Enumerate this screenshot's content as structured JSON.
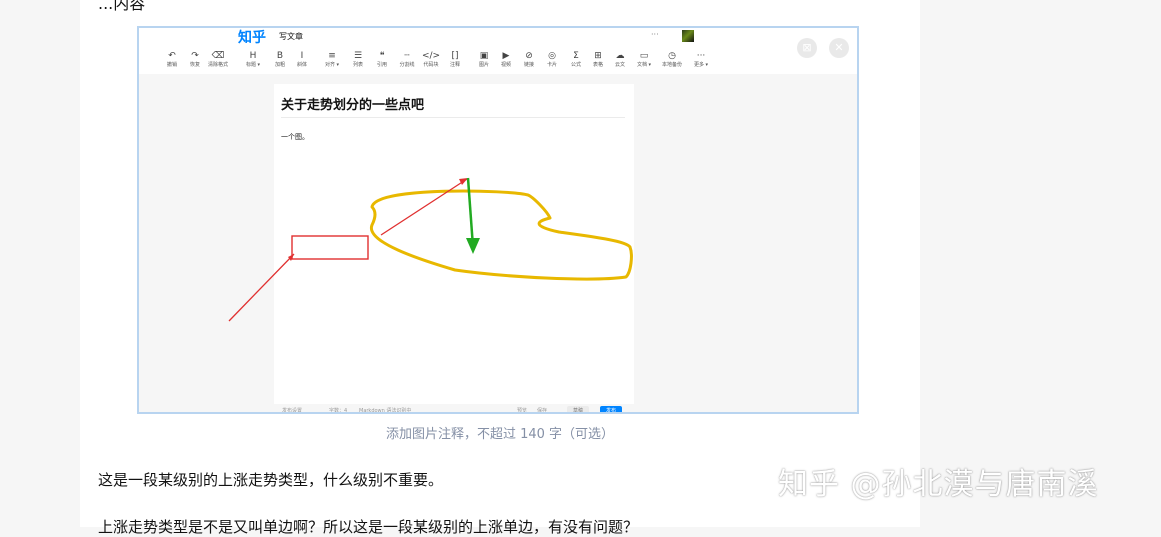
{
  "article": {
    "top_cut_text": "...内容",
    "caption": "添加图片注释，不超过 140 字（可选）",
    "paragraph1": "这是一段某级别的上涨走势类型，什么级别不重要。",
    "paragraph2": "上涨走势类型是不是又叫单边啊？所以这是一段某级别的上涨单边，有没有问题？"
  },
  "screenshot": {
    "header": {
      "logo": "知乎",
      "title": "写文章",
      "more": "···"
    },
    "toolbar": [
      {
        "icon": "undo-icon",
        "glyph": "↶",
        "label": "撤销"
      },
      {
        "icon": "redo-icon",
        "glyph": "↷",
        "label": "恢复"
      },
      {
        "icon": "clear-format-icon",
        "glyph": "⌫",
        "label": "清除格式"
      },
      {
        "icon": "heading-icon",
        "glyph": "H",
        "label": "标题 ▾"
      },
      {
        "icon": "bold-icon",
        "glyph": "B",
        "label": "加粗"
      },
      {
        "icon": "italic-icon",
        "glyph": "I",
        "label": "斜体"
      },
      {
        "icon": "align-icon",
        "glyph": "≡",
        "label": "对齐 ▾"
      },
      {
        "icon": "list-icon",
        "glyph": "☰",
        "label": "列表"
      },
      {
        "icon": "quote-icon",
        "glyph": "❝",
        "label": "引用"
      },
      {
        "icon": "divider-icon",
        "glyph": "┄",
        "label": "分割线"
      },
      {
        "icon": "code-block-icon",
        "glyph": "</>",
        "label": "代码块"
      },
      {
        "icon": "footnote-icon",
        "glyph": "[]",
        "label": "注释"
      },
      {
        "icon": "image-icon",
        "glyph": "▣",
        "label": "图片"
      },
      {
        "icon": "video-icon",
        "glyph": "▶",
        "label": "视频"
      },
      {
        "icon": "link-icon",
        "glyph": "⊘",
        "label": "链接"
      },
      {
        "icon": "card-icon",
        "glyph": "◎",
        "label": "卡片"
      },
      {
        "icon": "formula-icon",
        "glyph": "Σ",
        "label": "公式"
      },
      {
        "icon": "table-icon",
        "glyph": "⊞",
        "label": "表格"
      },
      {
        "icon": "cloud-icon",
        "glyph": "☁",
        "label": "云文"
      },
      {
        "icon": "doc-icon",
        "glyph": "▭",
        "label": "文档 ▾"
      },
      {
        "icon": "history-icon",
        "glyph": "◷",
        "label": "本地备份"
      },
      {
        "icon": "more-icon",
        "glyph": "···",
        "label": "更多 ▾"
      }
    ],
    "editor": {
      "title": "关于走势划分的一些点吧",
      "body": "一个图。"
    },
    "status_bar": {
      "left": "发布设置",
      "count": "字数：4",
      "markdown": "Markdown 语法识别中",
      "preview": "预览",
      "save": "保存",
      "draft": "草稿",
      "publish": "发布"
    },
    "annotation_colors": {
      "yellow": "#e8b800",
      "red": "#e03030",
      "green": "#22aa22"
    }
  },
  "watermark": "知乎 @孙北漠与唐南溪"
}
